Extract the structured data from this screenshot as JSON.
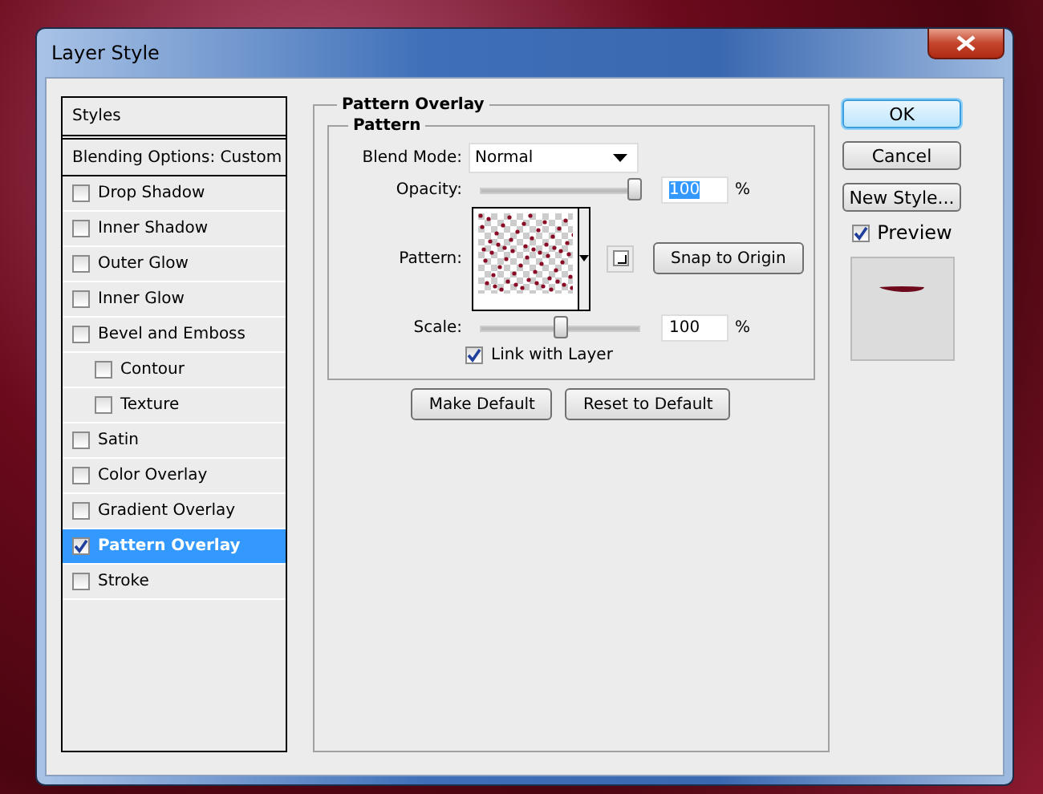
{
  "window": {
    "title": "Layer Style"
  },
  "styles_list": [
    {
      "label": "Styles",
      "kind": "header",
      "selected": false
    },
    {
      "label": "Blending Options: Custom",
      "kind": "header",
      "selected": false
    },
    {
      "label": "Drop Shadow",
      "kind": "effect",
      "checked": false,
      "selected": false
    },
    {
      "label": "Inner Shadow",
      "kind": "effect",
      "checked": false,
      "selected": false
    },
    {
      "label": "Outer Glow",
      "kind": "effect",
      "checked": false,
      "selected": false
    },
    {
      "label": "Inner Glow",
      "kind": "effect",
      "checked": false,
      "selected": false
    },
    {
      "label": "Bevel and Emboss",
      "kind": "effect",
      "checked": false,
      "selected": false,
      "children": [
        {
          "label": "Contour",
          "kind": "effect",
          "checked": false,
          "selected": false
        },
        {
          "label": "Texture",
          "kind": "effect",
          "checked": false,
          "selected": false
        }
      ]
    },
    {
      "label": "Satin",
      "kind": "effect",
      "checked": false,
      "selected": false
    },
    {
      "label": "Color Overlay",
      "kind": "effect",
      "checked": false,
      "selected": false
    },
    {
      "label": "Gradient Overlay",
      "kind": "effect",
      "checked": false,
      "selected": false
    },
    {
      "label": "Pattern Overlay",
      "kind": "effect",
      "checked": true,
      "selected": true
    },
    {
      "label": "Stroke",
      "kind": "effect",
      "checked": false,
      "selected": false
    }
  ],
  "panel": {
    "title": "Pattern Overlay",
    "group_title": "Pattern",
    "blend_mode": {
      "label": "Blend Mode:",
      "value": "Normal"
    },
    "opacity": {
      "label": "Opacity:",
      "level": 0.97,
      "value": "100",
      "unit": "%",
      "text_selected": true
    },
    "pattern": {
      "label": "Pattern:"
    },
    "snap_button": "Snap to Origin",
    "scale": {
      "label": "Scale:",
      "level": 0.5,
      "value": "100",
      "unit": "%",
      "text_selected": false
    },
    "link_with_layer": {
      "label": "Link with Layer",
      "checked": true
    },
    "buttons": [
      "Make Default",
      "Reset to Default"
    ]
  },
  "actions": {
    "buttons": [
      {
        "label": "OK",
        "default": true
      },
      {
        "label": "Cancel",
        "default": false
      },
      {
        "label": "New Style...",
        "default": false
      }
    ],
    "preview": {
      "label": "Preview",
      "checked": true
    }
  }
}
